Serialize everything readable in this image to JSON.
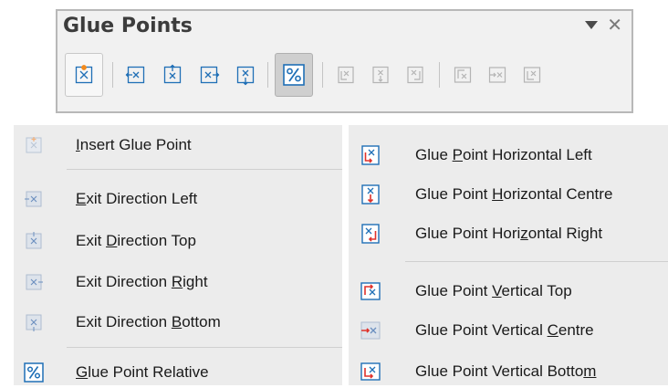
{
  "toolbar": {
    "title": "Glue Points",
    "menu_icon": "dropdown-triangle-icon",
    "close_icon": "close-x-icon",
    "buttons": [
      {
        "name": "insert-glue-point-icon",
        "state": "framed"
      },
      {
        "name": "exit-direction-left-icon",
        "state": "enabled"
      },
      {
        "name": "exit-direction-top-icon",
        "state": "enabled"
      },
      {
        "name": "exit-direction-right-icon",
        "state": "enabled"
      },
      {
        "name": "exit-direction-bottom-icon",
        "state": "enabled"
      },
      {
        "name": "glue-point-relative-icon",
        "state": "active"
      },
      {
        "name": "glue-point-horizontal-left-icon",
        "state": "disabled"
      },
      {
        "name": "glue-point-horizontal-centre-icon",
        "state": "disabled"
      },
      {
        "name": "glue-point-horizontal-right-icon",
        "state": "disabled"
      },
      {
        "name": "glue-point-vertical-top-icon",
        "state": "disabled"
      },
      {
        "name": "glue-point-vertical-centre-icon",
        "state": "disabled"
      },
      {
        "name": "glue-point-vertical-bottom-icon",
        "state": "disabled"
      }
    ]
  },
  "left_menu": {
    "items": [
      {
        "pre": "",
        "key": "I",
        "post": "nsert Glue Point",
        "icon": "insert-glue-point-icon"
      },
      {
        "pre": "",
        "key": "E",
        "post": "xit Direction Left",
        "icon": "exit-direction-left-icon"
      },
      {
        "pre": "Exit ",
        "key": "D",
        "post": "irection Top",
        "icon": "exit-direction-top-icon"
      },
      {
        "pre": "Exit Direction ",
        "key": "R",
        "post": "ight",
        "icon": "exit-direction-right-icon"
      },
      {
        "pre": "Exit Direction ",
        "key": "B",
        "post": "ottom",
        "icon": "exit-direction-bottom-icon"
      },
      {
        "pre": "",
        "key": "G",
        "post": "lue Point Relative",
        "icon": "glue-point-relative-icon"
      }
    ]
  },
  "right_menu": {
    "items": [
      {
        "pre": "Glue ",
        "key": "P",
        "post": "oint Horizontal Left",
        "icon": "glue-point-horizontal-left-icon"
      },
      {
        "pre": "Glue Point ",
        "key": "H",
        "post": "orizontal Centre",
        "icon": "glue-point-horizontal-centre-icon"
      },
      {
        "pre": "Glue Point Hori",
        "key": "z",
        "post": "ontal Right",
        "icon": "glue-point-horizontal-right-icon"
      },
      {
        "pre": "Glue Point ",
        "key": "V",
        "post": "ertical Top",
        "icon": "glue-point-vertical-top-icon"
      },
      {
        "pre": "Glue Point Vertical ",
        "key": "C",
        "post": "entre",
        "icon": "glue-point-vertical-centre-icon"
      },
      {
        "pre": "Glue Point Vertical Botto",
        "key": "m",
        "post": "",
        "icon": "glue-point-vertical-bottom-icon"
      }
    ]
  },
  "colors": {
    "icon_blue": "#1f6fb6",
    "icon_red": "#e0322b",
    "icon_orange": "#f28a1d",
    "icon_disabled": "#b4b4b4",
    "menu_bg": "#ececec",
    "toolbar_bg": "#f1f1f1"
  }
}
